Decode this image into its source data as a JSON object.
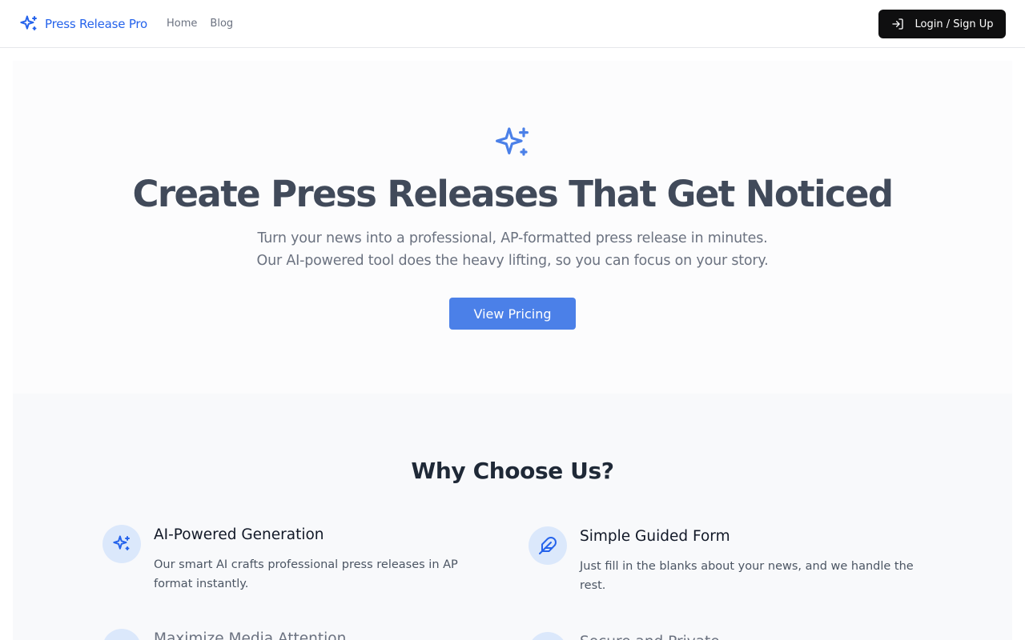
{
  "nav": {
    "brand": "Press Release Pro",
    "links": [
      "Home",
      "Blog"
    ],
    "login_label": "Login / Sign Up",
    "icons": {
      "brand": "sparkles-icon",
      "login": "log-in-icon"
    }
  },
  "hero": {
    "icon": "sparkles-icon",
    "title": "Create Press Releases That Get Noticed",
    "subtitle_line1": "Turn your news into a professional, AP-formatted press release in minutes.",
    "subtitle_line2": "Our AI-powered tool does the heavy lifting, so you can focus on your story.",
    "cta": "View Pricing"
  },
  "why": {
    "title": "Why Choose Us?",
    "features": [
      {
        "icon": "sparkles-icon",
        "title": "AI-Powered Generation",
        "desc": "Our smart AI crafts professional press releases in AP format instantly."
      },
      {
        "icon": "feather-icon",
        "title": "Simple Guided Form",
        "desc": "Just fill in the blanks about your news, and we handle the rest."
      },
      {
        "icon": "megaphone-icon",
        "title": "Maximize Media Attention",
        "desc": ""
      },
      {
        "icon": "lock-icon",
        "title": "Secure and Private",
        "desc": ""
      }
    ]
  },
  "colors": {
    "brand_blue": "#2563eb",
    "cta_blue": "#4b80e8",
    "login_bg": "#0f0f10",
    "icon_circle_bg": "#dbe8fb",
    "section_bg": "#f8f9fb"
  }
}
